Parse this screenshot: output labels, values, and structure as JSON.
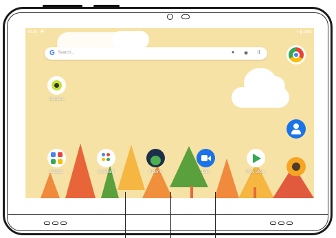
{
  "status": {
    "time": "06:25",
    "battery": "100%"
  },
  "search": {
    "placeholder": "Search...",
    "logo": "G",
    "icons": [
      "mic-icon",
      "lens-icon",
      "apps-grid-icon"
    ]
  },
  "apps": [
    {
      "label": "Camera",
      "color": "#ffffff"
    },
    {
      "label": "Google",
      "color": "#ffffff"
    },
    {
      "label": "Assistant",
      "color": "#ffffff"
    },
    {
      "label": "Kidomi",
      "color": "#1b2f4a"
    },
    {
      "label": "Duo",
      "color": "#1a73e8"
    },
    {
      "label": "Play Store",
      "color": "#ffffff"
    }
  ],
  "side": {
    "chrome_label": "Chrome",
    "contacts_label": "Contacts",
    "settings_label": "Settings"
  },
  "colors": {
    "wallpaper": "#f7e2a5",
    "tree_orange": "#e8653a",
    "tree_yellow": "#f5b642",
    "tree_green": "#5aa03c",
    "tree_red": "#e25a3e"
  }
}
